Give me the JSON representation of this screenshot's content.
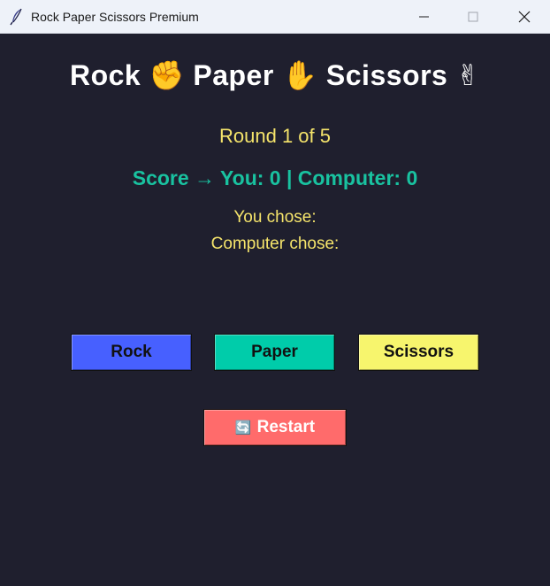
{
  "window": {
    "title": "Rock Paper Scissors Premium",
    "icon": "feather-icon",
    "controls": [
      "minimize-icon",
      "maximize-icon",
      "close-icon"
    ]
  },
  "game": {
    "title_parts": [
      "Rock",
      "✊",
      "Paper",
      "✋",
      "Scissors",
      "✌"
    ],
    "round_text": "Round 1 of 5",
    "score_text": "Score → You: 0 | Computer: 0",
    "you_chose": "You chose:",
    "computer_chose": "Computer chose:"
  },
  "buttons": {
    "rock": "Rock",
    "paper": "Paper",
    "scissors": "Scissors",
    "restart_icon": "🔄",
    "restart": "Restart"
  },
  "colors": {
    "background": "#1f1f2e",
    "rock": "#4760ff",
    "paper": "#00ccaa",
    "scissors": "#f7f56d",
    "restart": "#ff6b6b",
    "round_text": "#f5e46b",
    "score_text": "#19c2a0"
  }
}
